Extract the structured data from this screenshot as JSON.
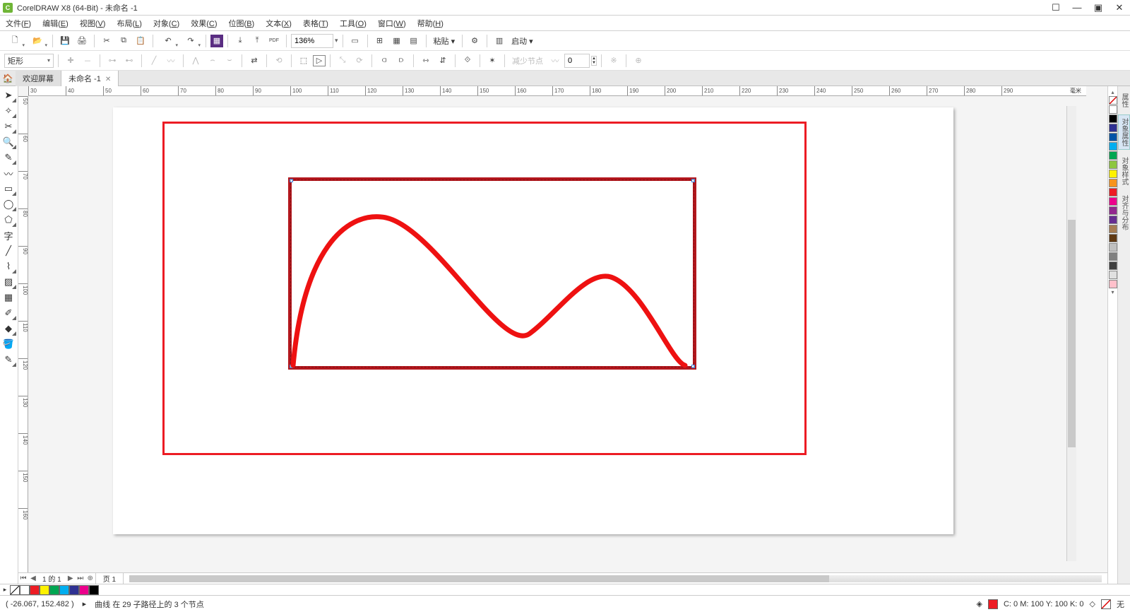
{
  "app": {
    "title": "CorelDRAW X8 (64-Bit) - 未命名 -1"
  },
  "menus": {
    "items": [
      {
        "l": "文件",
        "k": "F"
      },
      {
        "l": "编辑",
        "k": "E"
      },
      {
        "l": "视图",
        "k": "V"
      },
      {
        "l": "布局",
        "k": "L"
      },
      {
        "l": "对象",
        "k": "C"
      },
      {
        "l": "效果",
        "k": "C"
      },
      {
        "l": "位图",
        "k": "B"
      },
      {
        "l": "文本",
        "k": "X"
      },
      {
        "l": "表格",
        "k": "T"
      },
      {
        "l": "工具",
        "k": "O"
      },
      {
        "l": "窗口",
        "k": "W"
      },
      {
        "l": "帮助",
        "k": "H"
      }
    ]
  },
  "toolbar": {
    "zoom": "136%",
    "paste_label": "粘贴",
    "launch_label": "启动"
  },
  "propbar": {
    "shape_label": "矩形",
    "reduce_label": "减少节点",
    "stepper": "0"
  },
  "tabs": {
    "welcome": "欢迎屏幕",
    "doc": "未命名 -1"
  },
  "ruler": {
    "unit": "毫米",
    "h_ticks": [
      30,
      40,
      50,
      60,
      70,
      80,
      90,
      100,
      110,
      120,
      130,
      140,
      150,
      160,
      170,
      180,
      190,
      200,
      210,
      220,
      230,
      240,
      250,
      260,
      270,
      280,
      290
    ],
    "v_ticks": [
      50,
      60,
      70,
      80,
      90,
      100,
      110,
      120,
      130,
      140,
      150,
      160
    ]
  },
  "docker": {
    "tabs": [
      "属性",
      "对象属性",
      "对象样式",
      "对齐与分布"
    ]
  },
  "colors": {
    "strip": [
      "#ffffff",
      "#000000",
      "#2e3192",
      "#0054a6",
      "#00aeef",
      "#00a651",
      "#8dc63f",
      "#fff200",
      "#f7941d",
      "#ed1c24",
      "#ec008c",
      "#92278f",
      "#662d91",
      "#a67c52",
      "#603913",
      "#c0c0c0",
      "#808080",
      "#404040",
      "#e0e0e0",
      "#ffc0cb"
    ]
  },
  "footer_palette": [
    "#ffffff",
    "#ed1c24",
    "#fff200",
    "#00a651",
    "#00aeef",
    "#2e3192",
    "#ec008c",
    "#000000"
  ],
  "page_nav": {
    "range": "1 的 1",
    "page_label": "页 1"
  },
  "status": {
    "coords": "( -26.067, 152.482 )",
    "hint": "曲线 在 29 子路径上的 3 个节点",
    "fill_label": "C: 0 M: 100 Y: 100 K: 0",
    "none_label": "无"
  }
}
